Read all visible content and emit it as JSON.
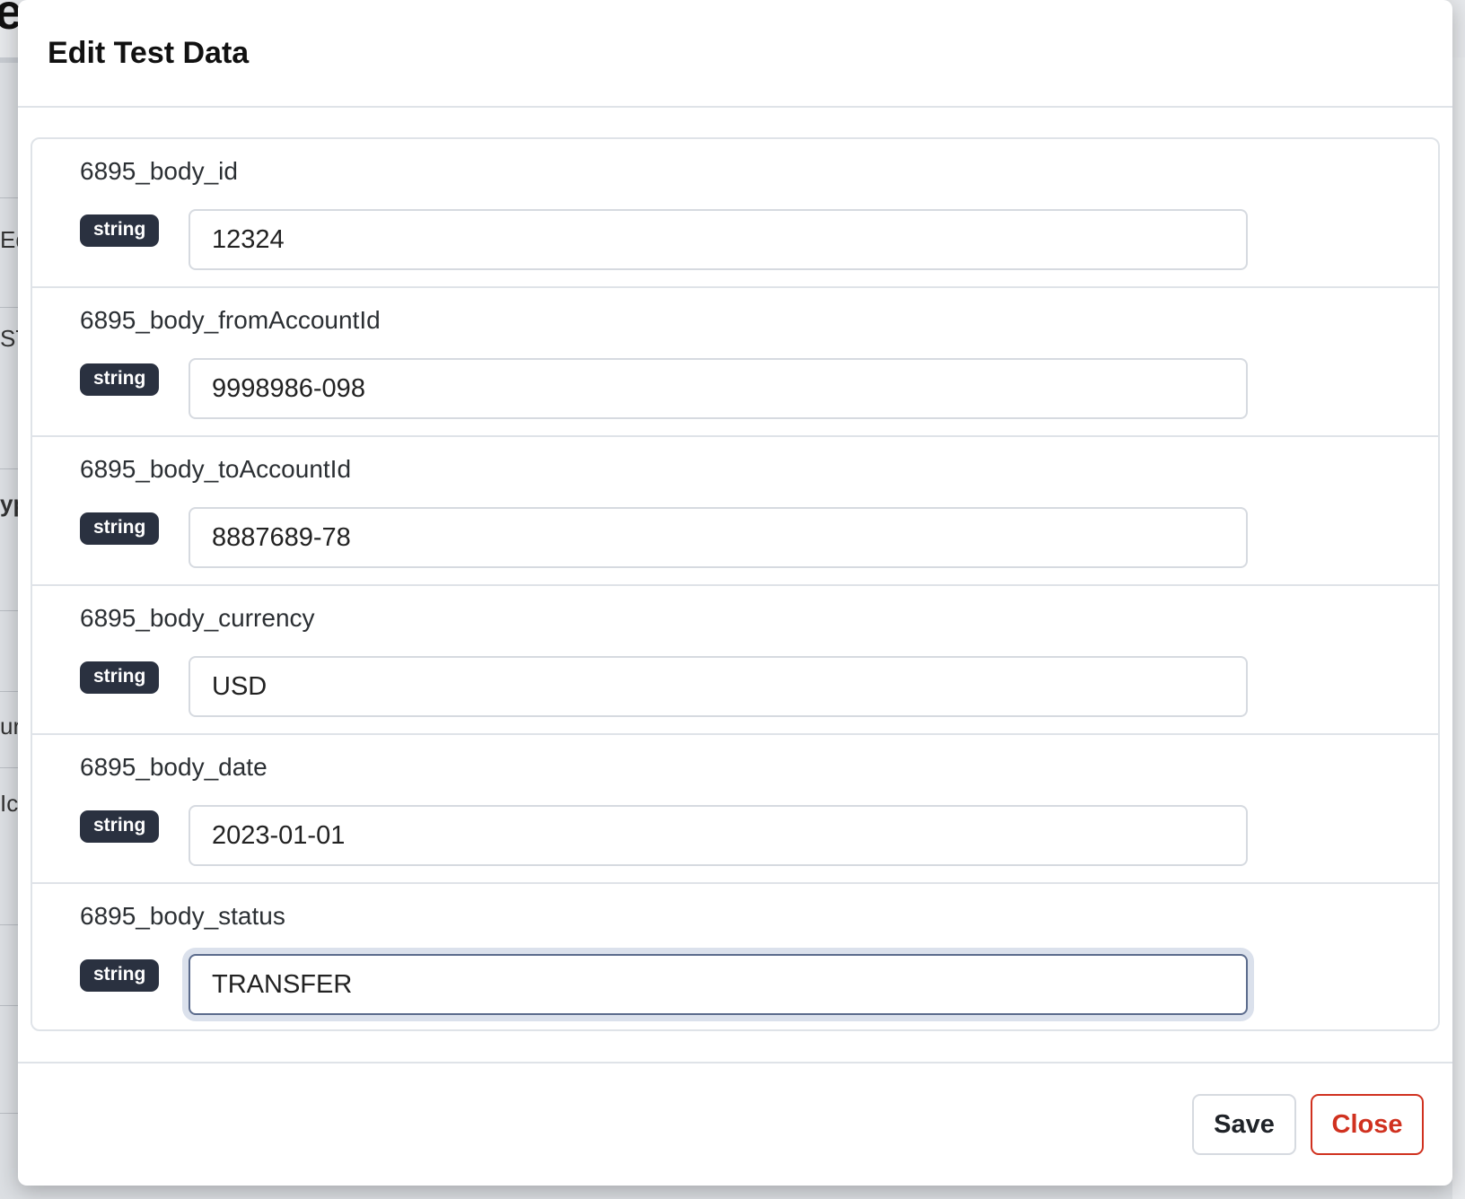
{
  "background": {
    "logo_fragment": "e",
    "edge_fragments": [
      "Ed",
      "ST",
      "yp",
      "ur",
      "Ic"
    ]
  },
  "modal": {
    "title": "Edit Test Data",
    "fields": [
      {
        "name": "6895_body_id",
        "type": "string",
        "value": "12324"
      },
      {
        "name": "6895_body_fromAccountId",
        "type": "string",
        "value": "9998986-098"
      },
      {
        "name": "6895_body_toAccountId",
        "type": "string",
        "value": "8887689-78"
      },
      {
        "name": "6895_body_currency",
        "type": "string",
        "value": "USD"
      },
      {
        "name": "6895_body_date",
        "type": "string",
        "value": "2023-01-01"
      },
      {
        "name": "6895_body_status",
        "type": "string",
        "value": "TRANSFER",
        "focused": true
      }
    ],
    "footer": {
      "save_label": "Save",
      "close_label": "Close"
    }
  },
  "colors": {
    "badge_bg": "#2a3140",
    "close_accent": "#d0311f",
    "focus_ring": "#dbe1ec"
  }
}
